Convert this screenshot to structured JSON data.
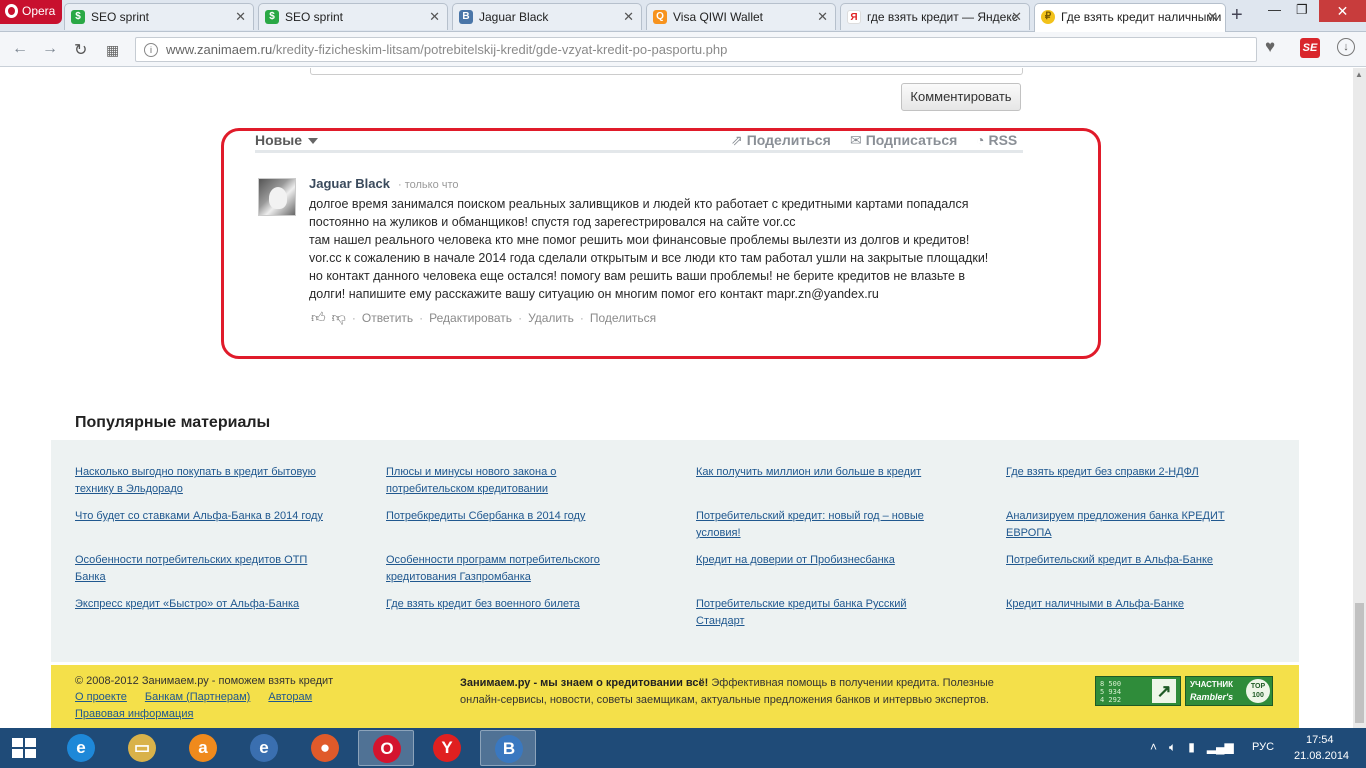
{
  "browser": {
    "menu_label": "Opera",
    "tabs": [
      {
        "title": "SEO sprint",
        "favicon": "seosprint-icon",
        "active": false
      },
      {
        "title": "SEO sprint",
        "favicon": "seosprint-icon",
        "active": false
      },
      {
        "title": "Jaguar Black",
        "favicon": "vk-icon",
        "active": false
      },
      {
        "title": "Visa QIWI Wallet",
        "favicon": "qiwi-icon",
        "active": false
      },
      {
        "title": "где взять кредит — Яндекс",
        "favicon": "yandex-icon",
        "active": false
      },
      {
        "title": "Где взять кредит наличными",
        "favicon": "zanimaem-icon",
        "active": true
      }
    ],
    "new_tab_symbol": "+",
    "window_buttons": {
      "minimize": "—",
      "maximize": "❐",
      "close": "✕"
    },
    "url_host": "www.zanimaem.ru",
    "url_path": "/kredity-fizicheskim-litsam/potrebitelskij-kredit/gde-vzyat-kredit-po-pasportu.php",
    "extension_label": "SE"
  },
  "comments": {
    "submit_label": "Комментировать",
    "sort_label": "Новые",
    "share_label": "Поделиться",
    "subscribe_label": "Подписаться",
    "rss_label": "RSS",
    "items": [
      {
        "author": "Jaguar Black",
        "time": "· только что",
        "lines": [
          "долгое время занимался поиском реальных заливщиков и людей кто работает с кредитными картами попадался",
          "постоянно на жуликов и обманщиков! спустя год зарегестрировался на сайте vor.cc",
          "там нашел реального человека кто мне помог решить мои финансовые проблемы вылезти из долгов и кредитов!",
          "vor.cc к сожалению в начале 2014 года сделали открытым и все люди кто там работал ушли на закрытые площадки!",
          "но контакт данного человека еще остался! помогу вам решить ваши проблемы! не берите кредитов не влазьте в",
          "долги! напишите ему расскажите вашу ситуацию он многим помог его контакт mapr.zn@yandex.ru"
        ],
        "actions": {
          "reply": "Ответить",
          "edit": "Редактировать",
          "delete": "Удалить",
          "share": "Поделиться"
        }
      }
    ],
    "highlight_color": "#e01b2a"
  },
  "popular": {
    "title": "Популярные материалы",
    "links": [
      [
        "Насколько выгодно покупать в кредит бытовую",
        "технику в Эльдорадо"
      ],
      [
        "Плюсы и минусы нового закона о",
        "потребительском кредитовании"
      ],
      [
        "Как получить миллион или больше в кредит"
      ],
      [
        "Где взять кредит без справки 2-НДФЛ"
      ],
      [
        "Что будет со ставками Альфа-Банка в 2014 году"
      ],
      [
        "Потребкредиты Сбербанка в 2014 году"
      ],
      [
        "Потребительский кредит: новый год – новые",
        "условия!"
      ],
      [
        "Анализируем предложения банка КРЕДИТ",
        "ЕВРОПА"
      ],
      [
        "Особенности потребительских кредитов ОТП",
        "Банка"
      ],
      [
        "Особенности программ потребительского",
        "кредитования Газпромбанка"
      ],
      [
        "Кредит на доверии от Пробизнесбанка"
      ],
      [
        "Потребительский кредит в Альфа-Банке"
      ],
      [
        "Экспресс кредит «Быстро» от Альфа-Банка"
      ],
      [
        "Где взять кредит без военного билета"
      ],
      [
        "Потребительские кредиты банка Русский",
        "Стандарт"
      ],
      [
        "Кредит наличными в Альфа-Банке"
      ]
    ]
  },
  "footer": {
    "copyright": "© 2008-2012 Занимаем.ру - поможем взять кредит",
    "links": [
      "О проекте",
      "Банкам (Партнерам)",
      "Авторам"
    ],
    "link_legal": "Правовая информация",
    "about_bold": "Занимаем.ру - мы знаем о кредитовании всё!",
    "about_text": " Эффективная помощь в получении кредита. Полезные онлайн-сервисы, новости, советы заемщикам, актуальные предложения банков и интервью экспертов.",
    "counter_digits": [
      "8 500",
      "5 934",
      "4 292"
    ],
    "rambler_line1": "УЧАСТНИК",
    "rambler_line2": "Rambler's",
    "rambler_badge": "TOP 100",
    "bg_color": "#f4e04a"
  },
  "taskbar": {
    "apps": [
      {
        "name": "internet-explorer",
        "glyph": "e",
        "color": "#1e88d8",
        "active": false
      },
      {
        "name": "file-explorer",
        "glyph": "▭",
        "color": "#d9b24a",
        "active": false
      },
      {
        "name": "avast",
        "glyph": "a",
        "color": "#f08a1c",
        "active": false
      },
      {
        "name": "chrome-app",
        "glyph": "e",
        "color": "#3a6fb0",
        "active": false
      },
      {
        "name": "colorful-app",
        "glyph": "●",
        "color": "#e05a2a",
        "active": false
      },
      {
        "name": "opera",
        "glyph": "O",
        "color": "#d4142e",
        "active": true
      },
      {
        "name": "yandex-browser",
        "glyph": "Y",
        "color": "#e02020",
        "active": false
      },
      {
        "name": "vk",
        "glyph": "B",
        "color": "#3a78c0",
        "active": true
      }
    ],
    "language": "РУС",
    "time": "17:54",
    "date": "21.08.2014"
  }
}
